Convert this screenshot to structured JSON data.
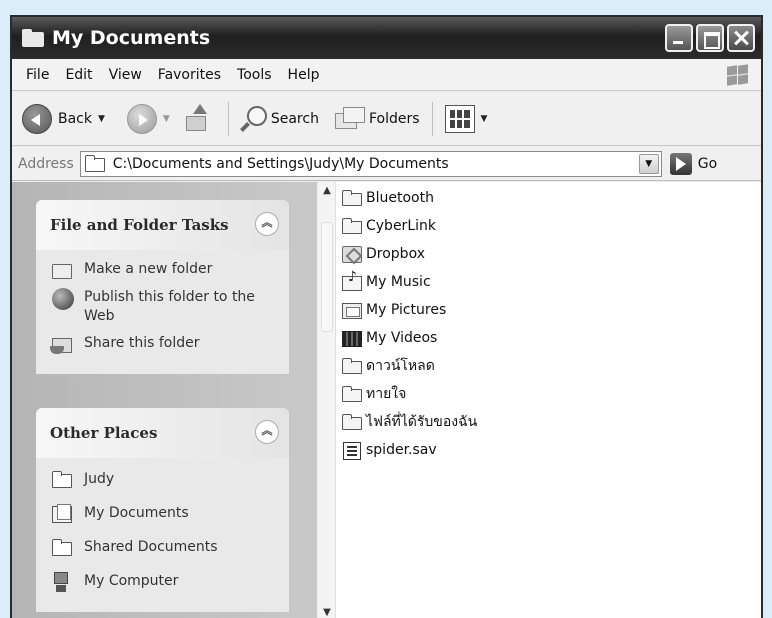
{
  "window": {
    "title": "My Documents"
  },
  "menu": [
    "File",
    "Edit",
    "View",
    "Favorites",
    "Tools",
    "Help"
  ],
  "toolbar": {
    "back": "Back",
    "search": "Search",
    "folders": "Folders"
  },
  "address": {
    "label": "Address",
    "value": "C:\\Documents and Settings\\Judy\\My Documents",
    "go": "Go"
  },
  "tasks_panel": {
    "title": "File and Folder Tasks",
    "items": [
      "Make a new folder",
      "Publish this folder to the Web",
      "Share this folder"
    ]
  },
  "places_panel": {
    "title": "Other Places",
    "items": [
      "Judy",
      "My Documents",
      "Shared Documents",
      "My Computer"
    ]
  },
  "files": [
    {
      "name": "Bluetooth",
      "icon": "folder-icon"
    },
    {
      "name": "CyberLink",
      "icon": "folder-icon"
    },
    {
      "name": "Dropbox",
      "icon": "dropbox-folder-icon"
    },
    {
      "name": "My Music",
      "icon": "music-folder-icon"
    },
    {
      "name": "My Pictures",
      "icon": "pictures-folder-icon"
    },
    {
      "name": "My Videos",
      "icon": "videos-folder-icon"
    },
    {
      "name": "ดาวน์โหลด",
      "icon": "folder-icon"
    },
    {
      "name": "ทายใจ",
      "icon": "folder-icon"
    },
    {
      "name": "ไฟล์ที่ได้รับของฉัน",
      "icon": "folder-icon"
    },
    {
      "name": "spider.sav",
      "icon": "sav-file-icon"
    }
  ]
}
